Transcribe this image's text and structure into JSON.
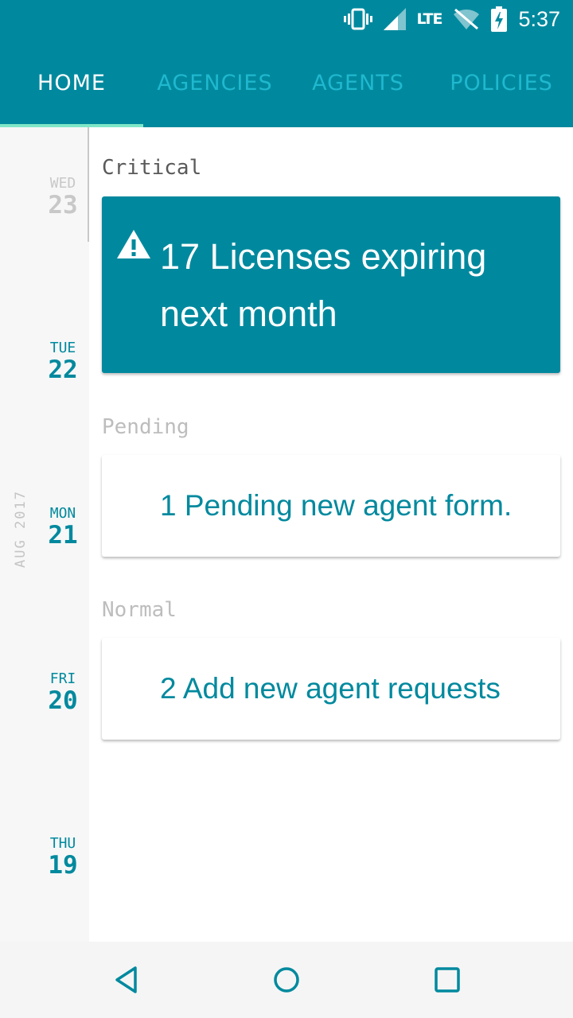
{
  "status_bar": {
    "network": "LTE",
    "time": "5:37",
    "icons": [
      "vibrate-icon",
      "signal-icon",
      "wifi-off-icon",
      "battery-charging-icon"
    ]
  },
  "tabs": [
    {
      "label": "HOME",
      "active": true
    },
    {
      "label": "AGENCIES",
      "active": false
    },
    {
      "label": "AGENTS",
      "active": false
    },
    {
      "label": "POLICIES",
      "active": false
    }
  ],
  "timeline": {
    "month": "AUG 2017",
    "days": [
      {
        "dow": "WED",
        "num": "23"
      },
      {
        "dow": "TUE",
        "num": "22"
      },
      {
        "dow": "MON",
        "num": "21"
      },
      {
        "dow": "FRI",
        "num": "20"
      },
      {
        "dow": "THU",
        "num": "19"
      }
    ]
  },
  "sections": {
    "critical": {
      "label": "Critical",
      "card_text": "17 Licenses expiring next month",
      "icon": "warning-icon"
    },
    "pending": {
      "label": "Pending",
      "card_text": "1 Pending new agent form."
    },
    "normal": {
      "label": "Normal",
      "card_text": "2 Add new agent requests"
    }
  },
  "colors": {
    "primary": "#00899e",
    "tab_inactive": "#1fb8cf",
    "tab_indicator": "#7fe7c7",
    "muted_text": "#bdbdbd"
  },
  "nav_bar": {
    "icons": [
      "back-icon",
      "home-icon",
      "recents-icon"
    ]
  }
}
